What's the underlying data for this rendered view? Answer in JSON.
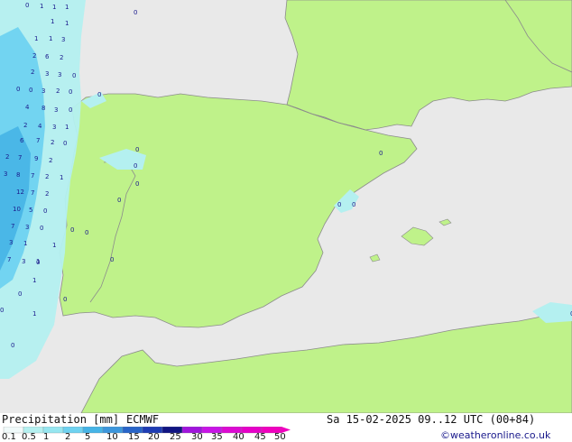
{
  "footer": {
    "title": "Precipitation [mm]",
    "model": "ECMWF",
    "datetime": "Sa 15-02-2025 09..12 UTC (00+84)",
    "credit": "©weatheronline.co.uk"
  },
  "colorbar": {
    "labels": [
      "0.1",
      "0.5",
      "1",
      "2",
      "5",
      "10",
      "15",
      "20",
      "25",
      "30",
      "35",
      "40",
      "45",
      "50"
    ],
    "colors": [
      "#f0fafa",
      "#b4f0f0",
      "#96e6f0",
      "#6ed2f0",
      "#46b4e6",
      "#3c96dc",
      "#2864c8",
      "#1e3cb4",
      "#101482",
      "#a014dc",
      "#c814e6",
      "#dc0ad2",
      "#e600c8",
      "#f000be"
    ]
  },
  "colors": {
    "sea": "#e9e9e9",
    "land": "#bff28a",
    "border": "#8c8c8c",
    "precip_light": "#b4f0f0",
    "precip_mid": "#6ed2f0",
    "precip_heavy": "#46b4e6",
    "value_text": "#1a1a8c"
  },
  "map_values": [
    {
      "t": "0"
    },
    {
      "t": "1"
    },
    {
      "t": "1"
    },
    {
      "t": "1"
    },
    {
      "t": "0"
    },
    {
      "t": "1"
    },
    {
      "t": "1"
    },
    {
      "t": "1"
    },
    {
      "t": "3"
    },
    {
      "t": "1"
    },
    {
      "t": "2"
    },
    {
      "t": "6"
    },
    {
      "t": "2"
    },
    {
      "t": "2"
    },
    {
      "t": "3"
    },
    {
      "t": "3"
    },
    {
      "t": "0"
    },
    {
      "t": "0"
    },
    {
      "t": "0"
    },
    {
      "t": "3"
    },
    {
      "t": "2"
    },
    {
      "t": "0"
    },
    {
      "t": "0"
    },
    {
      "t": "4"
    },
    {
      "t": "8"
    },
    {
      "t": "3"
    },
    {
      "t": "0"
    },
    {
      "t": "2"
    },
    {
      "t": "4"
    },
    {
      "t": "3"
    },
    {
      "t": "1"
    },
    {
      "t": "6"
    },
    {
      "t": "7"
    },
    {
      "t": "2"
    },
    {
      "t": "0"
    },
    {
      "t": "2"
    },
    {
      "t": "7"
    },
    {
      "t": "9"
    },
    {
      "t": "2"
    },
    {
      "t": "3"
    },
    {
      "t": "8"
    },
    {
      "t": "7"
    },
    {
      "t": "2"
    },
    {
      "t": "1"
    },
    {
      "t": "12"
    },
    {
      "t": "7"
    },
    {
      "t": "2"
    },
    {
      "t": "10"
    },
    {
      "t": "5"
    },
    {
      "t": "0"
    },
    {
      "t": "7"
    },
    {
      "t": "3"
    },
    {
      "t": "0"
    },
    {
      "t": "3"
    },
    {
      "t": "1"
    },
    {
      "t": "1"
    },
    {
      "t": "7"
    },
    {
      "t": "3"
    },
    {
      "t": "0"
    },
    {
      "t": "1"
    },
    {
      "t": "0"
    },
    {
      "t": "0"
    },
    {
      "t": "1"
    },
    {
      "t": "0"
    },
    {
      "t": "1"
    },
    {
      "t": "0"
    },
    {
      "t": "0"
    },
    {
      "t": "0"
    },
    {
      "t": "0"
    },
    {
      "t": "0"
    },
    {
      "t": "0"
    },
    {
      "t": "0"
    },
    {
      "t": "0"
    },
    {
      "t": "0"
    },
    {
      "t": "0"
    },
    {
      "t": "0"
    },
    {
      "t": "0"
    }
  ]
}
